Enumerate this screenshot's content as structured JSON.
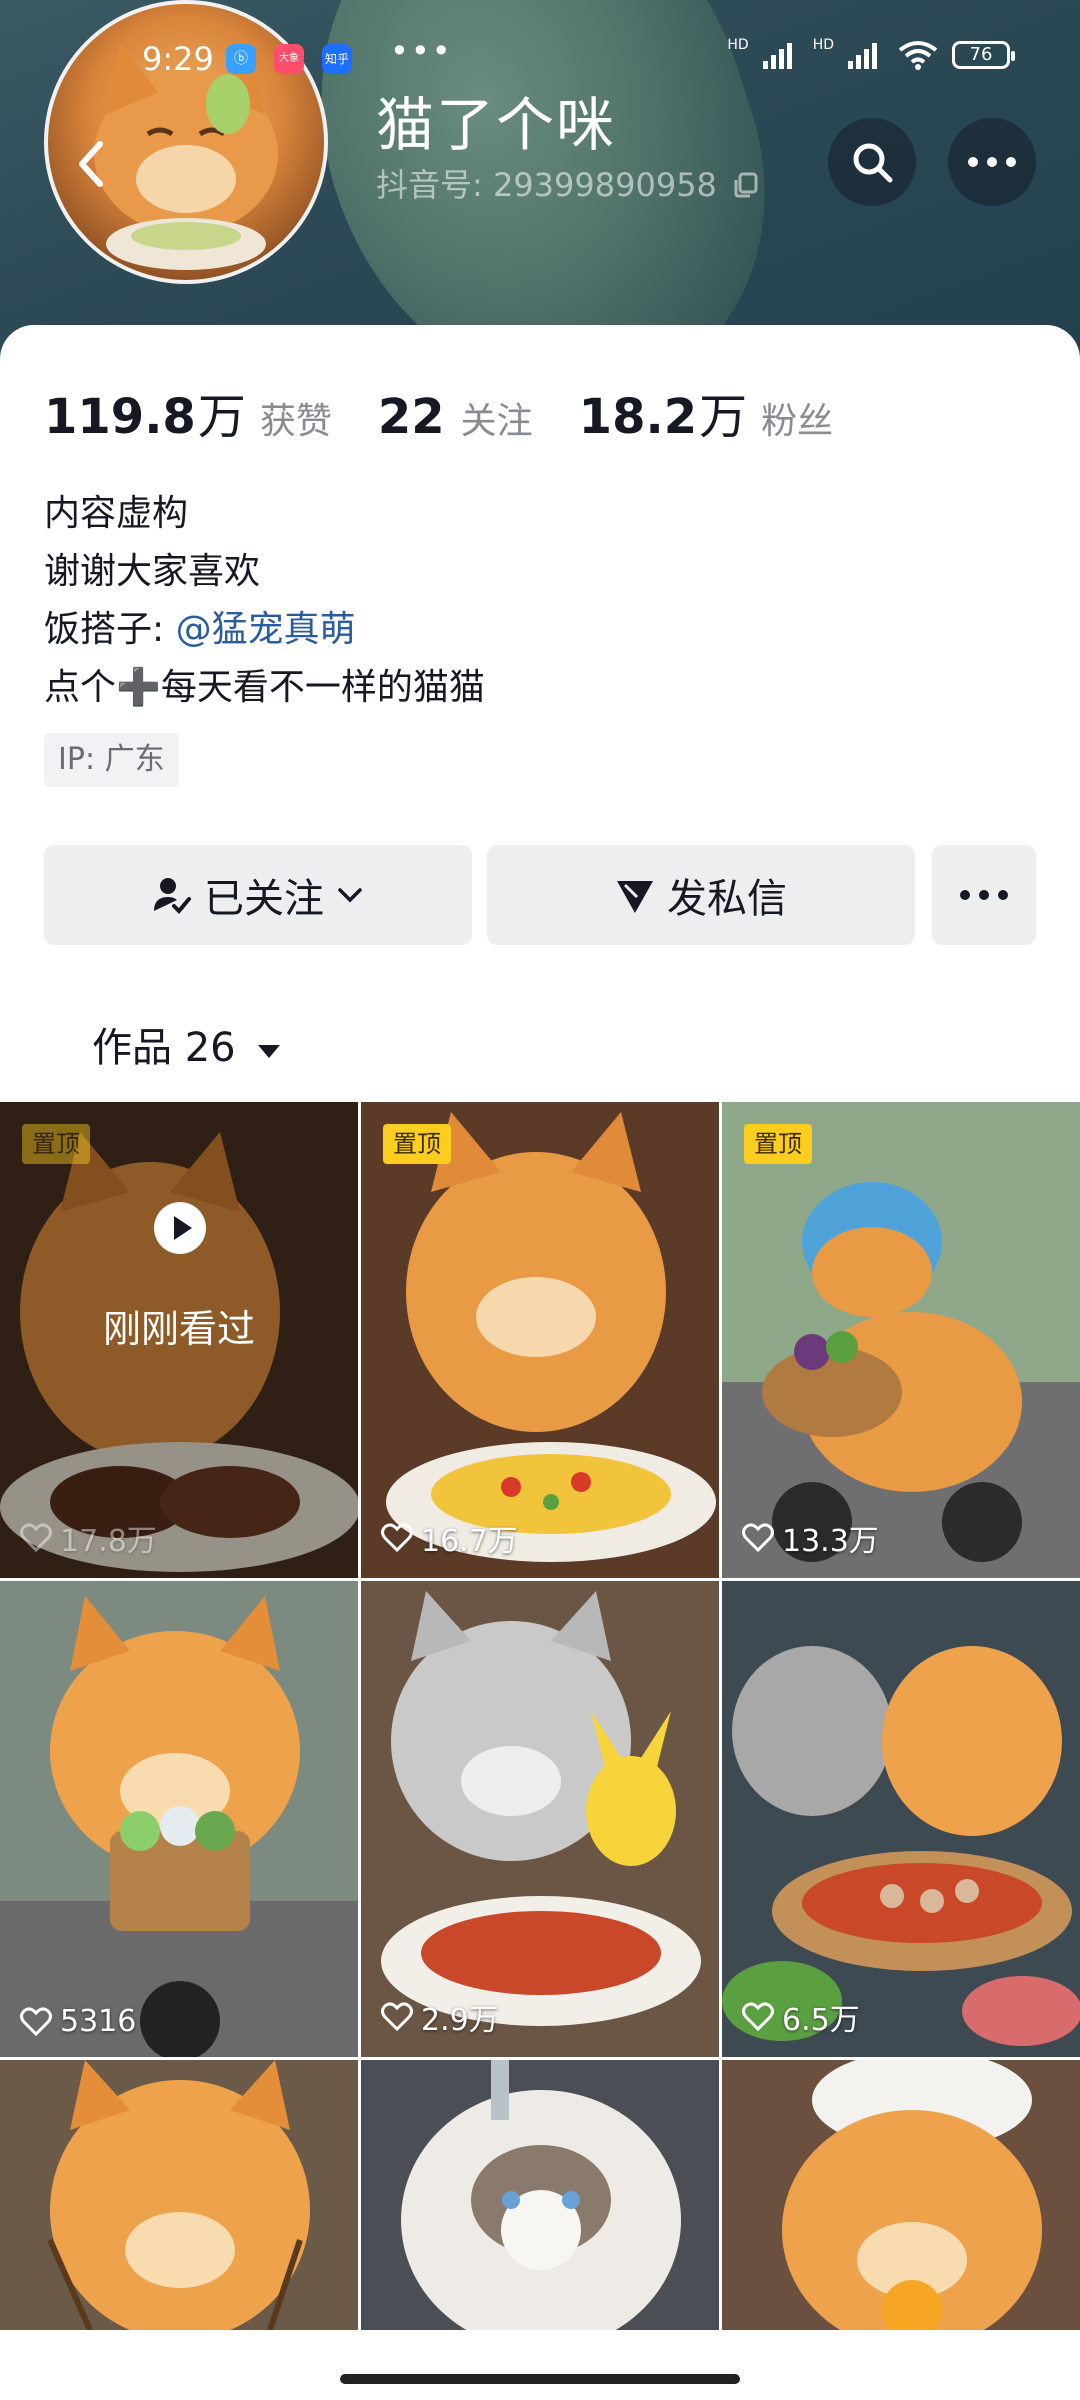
{
  "status_bar": {
    "time": "9:29",
    "app_icon_1": "ⓑ",
    "app_icon_2": "大象",
    "app_icon_3": "知乎",
    "more": "•••",
    "network_1": "HD",
    "network_2": "HD",
    "battery": "76"
  },
  "profile": {
    "name": "猫了个咪",
    "douyin_id": "抖音号: 29399890958",
    "stats": [
      {
        "value": "119.8",
        "unit": "万",
        "label": "获赞"
      },
      {
        "value": "22",
        "unit": "",
        "label": "关注"
      },
      {
        "value": "18.2",
        "unit": "万",
        "label": "粉丝"
      }
    ],
    "bio_lines": [
      "内容虚构",
      "谢谢大家喜欢",
      "饭搭子: ",
      "点个➕每天看不一样的猫猫"
    ],
    "bio_mention": "@猛宠真萌",
    "ip": "IP: 广东"
  },
  "actions": {
    "follow": "已关注",
    "message": "发私信",
    "more": "•••"
  },
  "works_tab": {
    "label": "作品 26"
  },
  "videos": [
    {
      "likes": "17.8万",
      "pinned": "置顶",
      "overlay": "刚刚看过",
      "theme": "steak"
    },
    {
      "likes": "16.7万",
      "pinned": "置顶",
      "theme": "rice"
    },
    {
      "likes": "13.3万",
      "pinned": "置顶",
      "theme": "scooter"
    },
    {
      "likes": "5316",
      "theme": "bike"
    },
    {
      "likes": "2.9万",
      "theme": "pikachu"
    },
    {
      "likes": "6.5万",
      "theme": "hotpot"
    },
    {
      "likes": "",
      "theme": "chopsticks"
    },
    {
      "likes": "",
      "theme": "ragdoll"
    },
    {
      "likes": "",
      "theme": "chef"
    }
  ],
  "colors": {
    "accent_link": "#2b5c9e",
    "pin_badge": "#fbcd1f",
    "button_bg": "#eeeef0"
  }
}
